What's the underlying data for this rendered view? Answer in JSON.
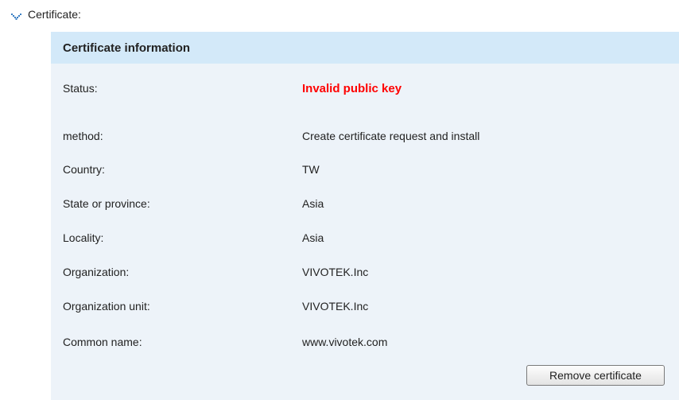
{
  "section": {
    "title": "Certificate:"
  },
  "panel": {
    "title": "Certificate information"
  },
  "fields": [
    {
      "label": "Status:",
      "value": "Invalid public key"
    },
    {
      "label": "method:",
      "value": "Create certificate request and install"
    },
    {
      "label": "Country:",
      "value": "TW"
    },
    {
      "label": "State or province:",
      "value": "Asia"
    },
    {
      "label": "Locality:",
      "value": "Asia"
    },
    {
      "label": "Organization:",
      "value": "VIVOTEK.Inc"
    },
    {
      "label": "Organization unit:",
      "value": "VIVOTEK.Inc"
    },
    {
      "label": "Common name:",
      "value": "www.vivotek.com"
    }
  ],
  "actions": {
    "remove_label": "Remove certificate"
  },
  "colors": {
    "status_invalid": "#ff0000",
    "panel_header": "#d3e9f9",
    "panel_body": "#edf3f9"
  }
}
